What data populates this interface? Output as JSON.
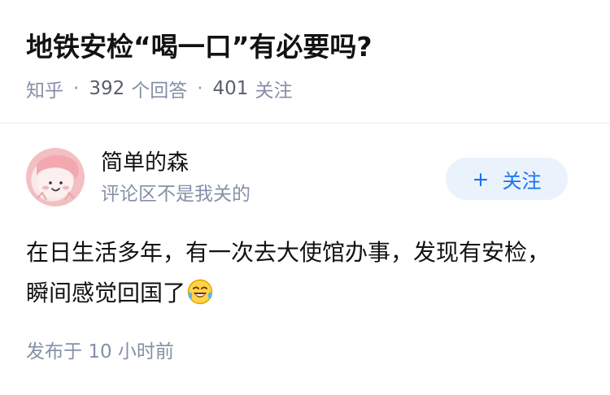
{
  "question": {
    "title": "地铁安检“喝一口”有必要吗?",
    "source": "知乎",
    "separator": "·",
    "answer_count": "392",
    "answer_label": "个回答",
    "follower_count": "401",
    "follower_label": "关注"
  },
  "answer": {
    "author_name": "简单的森",
    "author_bio": "评论区不是我关的",
    "follow_label": "关注",
    "follow_icon": "plus-icon",
    "content": "在日生活多年，有一次去大使馆办事，发现有安检，瞬间感觉回国了",
    "emoji": "laughing-with-tears-emoji",
    "publish_prefix": "发布于",
    "publish_time": "10 小时前"
  },
  "colors": {
    "title": "#121212",
    "meta": "#8590a6",
    "follow_bg": "#eaf2fb",
    "follow_text": "#1772f6",
    "divider": "#ebebeb"
  }
}
